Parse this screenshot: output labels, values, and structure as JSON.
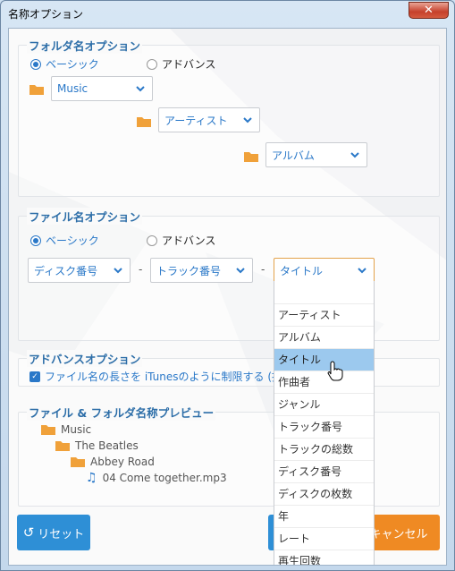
{
  "window": {
    "title": "名称オプション",
    "close_glyph": "✕"
  },
  "folder_options": {
    "title": "フォルダ名オプション",
    "mode_basic": "ベーシック",
    "mode_advanced": "アドバンス",
    "selected_mode": "basic",
    "level1": "Music",
    "level2": "アーティスト",
    "level3": "アルバム"
  },
  "file_options": {
    "title": "ファイル名オプション",
    "mode_basic": "ベーシック",
    "mode_advanced": "アドバンス",
    "selected_mode": "basic",
    "part1": "ディスク番号",
    "sep1": "-",
    "part2": "トラック番号",
    "sep2": "-",
    "part3": "タイトル"
  },
  "advanced_options": {
    "title": "アドバンスオプション",
    "limit_length_label": "ファイル名の長さを iTunesのように制限する (推奨",
    "limit_length_checked": true
  },
  "preview": {
    "title": "ファイル & フォルダ名称プレビュー",
    "items": [
      "Music",
      "The Beatles",
      "Abbey Road",
      "04 Come together.mp3"
    ]
  },
  "buttons": {
    "reset": "リセット",
    "cancel": "キャンセル"
  },
  "dropdown": {
    "options": [
      "",
      "アーティスト",
      "アルバム",
      "タイトル",
      "作曲者",
      "ジャンル",
      "トラック番号",
      "トラックの総数",
      "ディスク番号",
      "ディスクの枚数",
      "年",
      "レート",
      "再生回数"
    ],
    "selected": "タイトル"
  },
  "icons": [
    "close-icon",
    "radio-icon",
    "folder-icon",
    "chevron-down-icon",
    "checkbox-icon",
    "music-note-icon",
    "reset-icon",
    "hand-cursor-icon"
  ],
  "colors": {
    "accent_blue": "#2a78c8",
    "folder_orange": "#f0a13a",
    "button_blue": "#2e8fd6",
    "button_orange": "#ef8a23",
    "selected_option": "#9cc9ee"
  }
}
